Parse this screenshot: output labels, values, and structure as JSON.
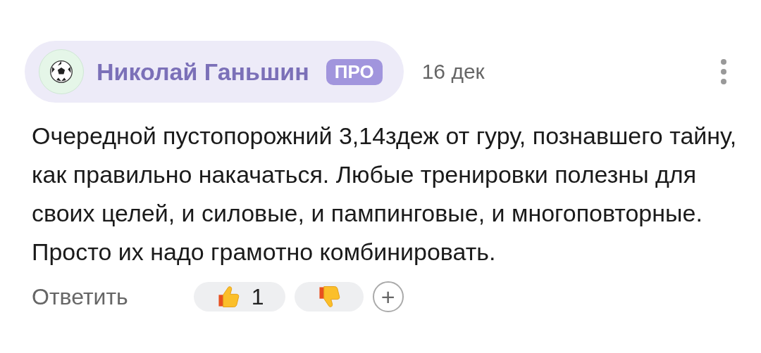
{
  "author": {
    "name": "Николай Ганьшин",
    "badge": "ПРО"
  },
  "date": "16 дек",
  "text": "Очередной пустопорожний 3,14здеж от гуру, познавшего тайну, как правильно накачаться. Любые тренировки полезны для своих целей, и силовые, и пампинговые, и многоповторные. Просто их надо грамотно комбинировать.",
  "reply": "Ответить",
  "reactions": [
    {
      "kind": "like",
      "count": "1"
    },
    {
      "kind": "dislike"
    }
  ],
  "add": "+"
}
